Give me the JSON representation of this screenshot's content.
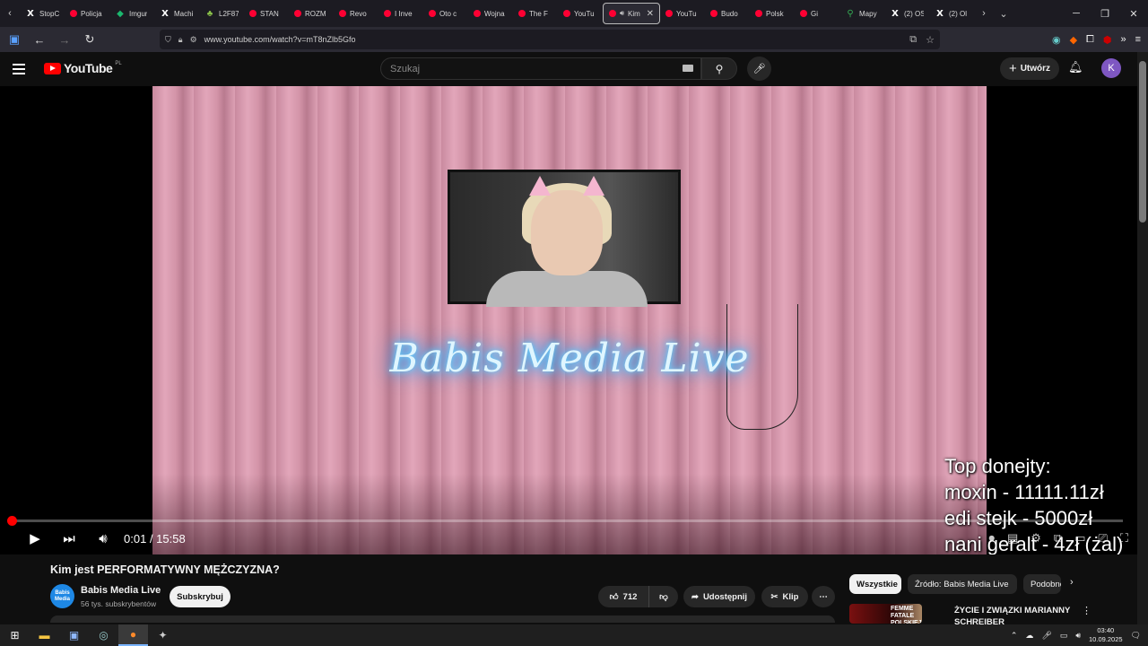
{
  "browser": {
    "tabs": [
      {
        "icon": "x",
        "label": "StopC"
      },
      {
        "icon": "yt",
        "label": "Policja"
      },
      {
        "icon": "imgur",
        "label": "Imgur"
      },
      {
        "icon": "x",
        "label": "Machi"
      },
      {
        "icon": "leaf",
        "label": "L2F87"
      },
      {
        "icon": "yt",
        "label": "STAN"
      },
      {
        "icon": "yt",
        "label": "ROZM"
      },
      {
        "icon": "yt",
        "label": "Revo"
      },
      {
        "icon": "yt",
        "label": "I Inve"
      },
      {
        "icon": "yt",
        "label": "Oto c"
      },
      {
        "icon": "yt",
        "label": "Wojna"
      },
      {
        "icon": "yt",
        "label": "The F"
      },
      {
        "icon": "yt",
        "label": "YouTu"
      },
      {
        "icon": "yt",
        "label": "Kim",
        "active": true
      },
      {
        "icon": "yt",
        "label": "YouTu"
      },
      {
        "icon": "yt",
        "label": "Budo"
      },
      {
        "icon": "yt",
        "label": "Polsk"
      },
      {
        "icon": "yt",
        "label": "Gi"
      },
      {
        "icon": "maps",
        "label": "Mapy"
      },
      {
        "icon": "x",
        "label": "(2) OS"
      },
      {
        "icon": "x",
        "label": "(2) Ol"
      }
    ],
    "url": "www.youtube.com/watch?v=mT8nZlb5Gfo"
  },
  "youtube": {
    "logo_text": "YouTube",
    "country_code": "PL",
    "search_placeholder": "Szukaj",
    "create_label": "Utwórz",
    "avatar_letter": "K"
  },
  "video": {
    "overlay_sign": "Babis Media Live",
    "donations": [
      "Top donejty:",
      "moxin - 11111.11zł",
      "edi stejk - 5000zł",
      "nani geralt - 4zł (żal)"
    ],
    "current_time": "0:01",
    "duration": "15:58",
    "progress_fraction": 0.001
  },
  "details": {
    "title": "Kim jest PERFORMATYWNY MĘŻCZYZNA?",
    "channel_name": "Babis Media Live",
    "channel_avatar_text": "Babis Media",
    "subscribers": "56 tys. subskrybentów",
    "subscribe_label": "Subskrybuj",
    "likes": "712",
    "share_label": "Udostępnij",
    "clip_label": "Klip"
  },
  "related": {
    "chips": [
      "Wszystkie",
      "Źródło: Babis Media Live",
      "Podobne"
    ],
    "first_thumb_text": "FEMME FATALE POLSKIEJ PRAWICY",
    "first_title": "ŻYCIE I ZWIĄZKI MARIANNY SCHREIBER"
  },
  "taskbar": {
    "time": "03:40",
    "date": "10.09.2025"
  }
}
